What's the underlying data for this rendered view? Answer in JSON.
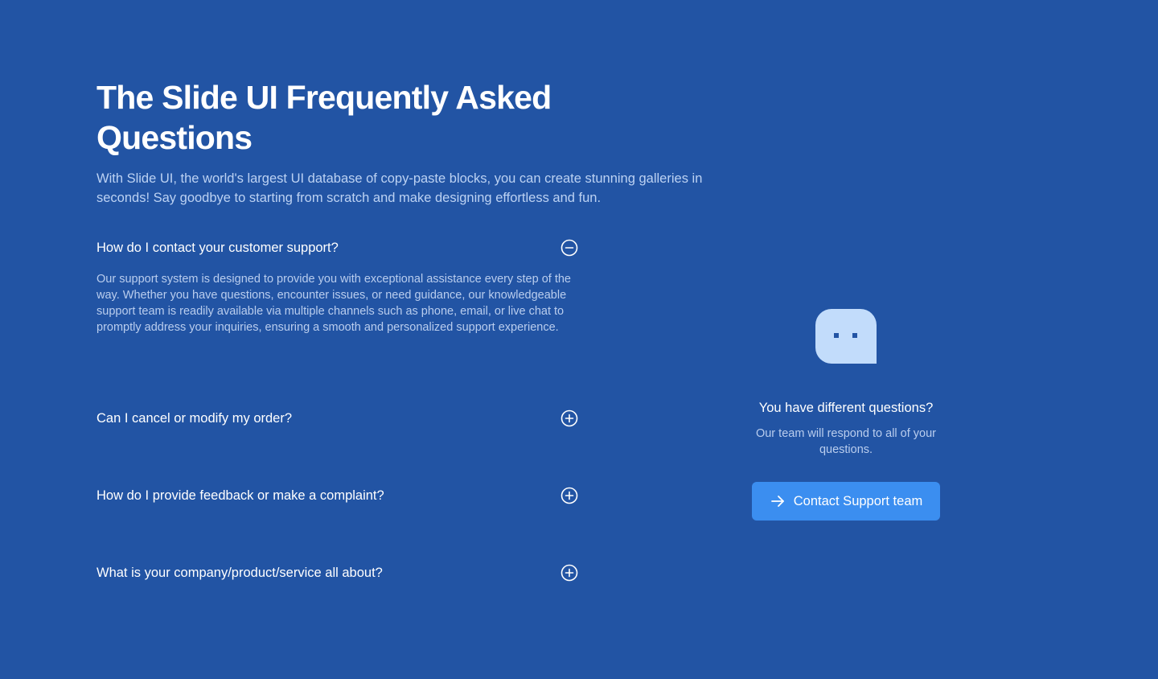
{
  "hero": {
    "title": "The Slide UI Frequently Asked Questions",
    "subtitle": "With Slide UI, the world's largest UI database of copy-paste blocks, you can create stunning galleries in seconds! Say goodbye to starting from scratch and make designing effortless and fun."
  },
  "faq": {
    "items": [
      {
        "question": "How do I contact your customer support?",
        "answer": "Our support system is designed to provide you with exceptional assistance every step of the way. Whether you have questions, encounter issues, or need guidance, our knowledgeable support team is readily available via multiple channels such as phone, email, or live chat to promptly address your inquiries, ensuring a smooth and personalized support experience.",
        "expanded": true,
        "icon": "minus-circle-icon"
      },
      {
        "question": "Can I cancel or modify my order?",
        "expanded": false,
        "icon": "plus-circle-icon"
      },
      {
        "question": "How do I provide feedback or make a complaint?",
        "expanded": false,
        "icon": "plus-circle-icon"
      },
      {
        "question": "What is your company/product/service all about?",
        "expanded": false,
        "icon": "plus-circle-icon"
      }
    ]
  },
  "support": {
    "icon": "chat-bubble-icon",
    "title": "You have different questions?",
    "subtitle": "Our team will respond to all of your questions.",
    "button_label": "Contact Support team",
    "button_icon": "arrow-right-icon"
  },
  "colors": {
    "background": "#2254a4",
    "button": "#3b8ef0",
    "bubble": "#c2dcfb",
    "muted_text": "#b9cdee"
  }
}
